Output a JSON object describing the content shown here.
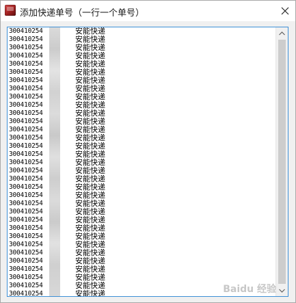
{
  "window": {
    "title": "添加快递单号（一行一个单号）",
    "app_icon": "app-icon",
    "close_icon": "close-icon"
  },
  "textarea": {
    "rows": [
      {
        "tracking": "300410254",
        "courier": "安能快递"
      },
      {
        "tracking": "300410254",
        "courier": "安能快递"
      },
      {
        "tracking": "300410254",
        "courier": "安能快递"
      },
      {
        "tracking": "300410254",
        "courier": "安能快递"
      },
      {
        "tracking": "300410254",
        "courier": "安能快递"
      },
      {
        "tracking": "300410254",
        "courier": "安能快递"
      },
      {
        "tracking": "300410254",
        "courier": "安能快递"
      },
      {
        "tracking": "300410254",
        "courier": "安能快递"
      },
      {
        "tracking": "300410254",
        "courier": "安能快递"
      },
      {
        "tracking": "300410254",
        "courier": "安能快递"
      },
      {
        "tracking": "300410254",
        "courier": "安能快递"
      },
      {
        "tracking": "300410254",
        "courier": "安能快递"
      },
      {
        "tracking": "300410254",
        "courier": "安能快递"
      },
      {
        "tracking": "300410254",
        "courier": "安能快递"
      },
      {
        "tracking": "300410254",
        "courier": "安能快递"
      },
      {
        "tracking": "300410254",
        "courier": "安能快递"
      },
      {
        "tracking": "300410254",
        "courier": "安能快递"
      },
      {
        "tracking": "300410254",
        "courier": "安能快递"
      },
      {
        "tracking": "300410254",
        "courier": "安能快递"
      },
      {
        "tracking": "300410254",
        "courier": "安能快递"
      },
      {
        "tracking": "300410254",
        "courier": "安能快递"
      },
      {
        "tracking": "300410254",
        "courier": "安能快递"
      },
      {
        "tracking": "300410254",
        "courier": "安能快递"
      },
      {
        "tracking": "300410254",
        "courier": "安能快递"
      },
      {
        "tracking": "300410254",
        "courier": "安能快递"
      },
      {
        "tracking": "300410254",
        "courier": "安能快递"
      },
      {
        "tracking": "300410254",
        "courier": "安能快递"
      },
      {
        "tracking": "300410254",
        "courier": "安能快递"
      },
      {
        "tracking": "300410254",
        "courier": "安能快递"
      },
      {
        "tracking": "300410254",
        "courier": "安能快递"
      },
      {
        "tracking": "300410254",
        "courier": "安能快递"
      },
      {
        "tracking": "300410254",
        "courier": "安能快递"
      },
      {
        "tracking": "300410254",
        "courier": "安能快递"
      }
    ]
  },
  "scrollbar": {
    "up_icon": "scroll-up-arrow-icon",
    "down_icon": "scroll-down-arrow-icon"
  },
  "watermark": "Baidu 经验",
  "colors": {
    "focus_border": "#3c8fd6",
    "dialog_background": "#f0f0f0",
    "scrollbar_thumb": "#cdcdcd"
  }
}
